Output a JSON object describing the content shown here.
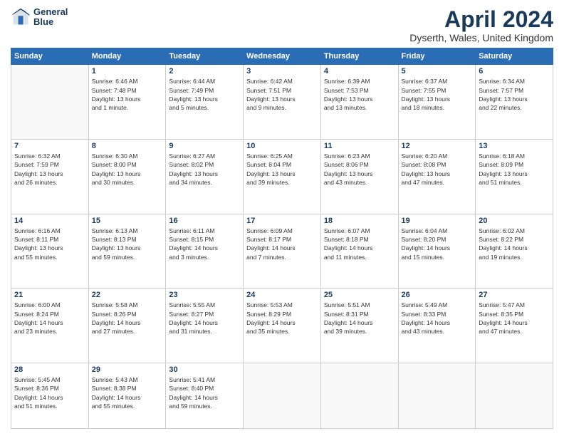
{
  "header": {
    "logo_line1": "General",
    "logo_line2": "Blue",
    "month": "April 2024",
    "location": "Dyserth, Wales, United Kingdom"
  },
  "days_of_week": [
    "Sunday",
    "Monday",
    "Tuesday",
    "Wednesday",
    "Thursday",
    "Friday",
    "Saturday"
  ],
  "weeks": [
    [
      {
        "day": "",
        "info": ""
      },
      {
        "day": "1",
        "info": "Sunrise: 6:46 AM\nSunset: 7:48 PM\nDaylight: 13 hours\nand 1 minute."
      },
      {
        "day": "2",
        "info": "Sunrise: 6:44 AM\nSunset: 7:49 PM\nDaylight: 13 hours\nand 5 minutes."
      },
      {
        "day": "3",
        "info": "Sunrise: 6:42 AM\nSunset: 7:51 PM\nDaylight: 13 hours\nand 9 minutes."
      },
      {
        "day": "4",
        "info": "Sunrise: 6:39 AM\nSunset: 7:53 PM\nDaylight: 13 hours\nand 13 minutes."
      },
      {
        "day": "5",
        "info": "Sunrise: 6:37 AM\nSunset: 7:55 PM\nDaylight: 13 hours\nand 18 minutes."
      },
      {
        "day": "6",
        "info": "Sunrise: 6:34 AM\nSunset: 7:57 PM\nDaylight: 13 hours\nand 22 minutes."
      }
    ],
    [
      {
        "day": "7",
        "info": "Sunrise: 6:32 AM\nSunset: 7:59 PM\nDaylight: 13 hours\nand 26 minutes."
      },
      {
        "day": "8",
        "info": "Sunrise: 6:30 AM\nSunset: 8:00 PM\nDaylight: 13 hours\nand 30 minutes."
      },
      {
        "day": "9",
        "info": "Sunrise: 6:27 AM\nSunset: 8:02 PM\nDaylight: 13 hours\nand 34 minutes."
      },
      {
        "day": "10",
        "info": "Sunrise: 6:25 AM\nSunset: 8:04 PM\nDaylight: 13 hours\nand 39 minutes."
      },
      {
        "day": "11",
        "info": "Sunrise: 6:23 AM\nSunset: 8:06 PM\nDaylight: 13 hours\nand 43 minutes."
      },
      {
        "day": "12",
        "info": "Sunrise: 6:20 AM\nSunset: 8:08 PM\nDaylight: 13 hours\nand 47 minutes."
      },
      {
        "day": "13",
        "info": "Sunrise: 6:18 AM\nSunset: 8:09 PM\nDaylight: 13 hours\nand 51 minutes."
      }
    ],
    [
      {
        "day": "14",
        "info": "Sunrise: 6:16 AM\nSunset: 8:11 PM\nDaylight: 13 hours\nand 55 minutes."
      },
      {
        "day": "15",
        "info": "Sunrise: 6:13 AM\nSunset: 8:13 PM\nDaylight: 13 hours\nand 59 minutes."
      },
      {
        "day": "16",
        "info": "Sunrise: 6:11 AM\nSunset: 8:15 PM\nDaylight: 14 hours\nand 3 minutes."
      },
      {
        "day": "17",
        "info": "Sunrise: 6:09 AM\nSunset: 8:17 PM\nDaylight: 14 hours\nand 7 minutes."
      },
      {
        "day": "18",
        "info": "Sunrise: 6:07 AM\nSunset: 8:18 PM\nDaylight: 14 hours\nand 11 minutes."
      },
      {
        "day": "19",
        "info": "Sunrise: 6:04 AM\nSunset: 8:20 PM\nDaylight: 14 hours\nand 15 minutes."
      },
      {
        "day": "20",
        "info": "Sunrise: 6:02 AM\nSunset: 8:22 PM\nDaylight: 14 hours\nand 19 minutes."
      }
    ],
    [
      {
        "day": "21",
        "info": "Sunrise: 6:00 AM\nSunset: 8:24 PM\nDaylight: 14 hours\nand 23 minutes."
      },
      {
        "day": "22",
        "info": "Sunrise: 5:58 AM\nSunset: 8:26 PM\nDaylight: 14 hours\nand 27 minutes."
      },
      {
        "day": "23",
        "info": "Sunrise: 5:55 AM\nSunset: 8:27 PM\nDaylight: 14 hours\nand 31 minutes."
      },
      {
        "day": "24",
        "info": "Sunrise: 5:53 AM\nSunset: 8:29 PM\nDaylight: 14 hours\nand 35 minutes."
      },
      {
        "day": "25",
        "info": "Sunrise: 5:51 AM\nSunset: 8:31 PM\nDaylight: 14 hours\nand 39 minutes."
      },
      {
        "day": "26",
        "info": "Sunrise: 5:49 AM\nSunset: 8:33 PM\nDaylight: 14 hours\nand 43 minutes."
      },
      {
        "day": "27",
        "info": "Sunrise: 5:47 AM\nSunset: 8:35 PM\nDaylight: 14 hours\nand 47 minutes."
      }
    ],
    [
      {
        "day": "28",
        "info": "Sunrise: 5:45 AM\nSunset: 8:36 PM\nDaylight: 14 hours\nand 51 minutes."
      },
      {
        "day": "29",
        "info": "Sunrise: 5:43 AM\nSunset: 8:38 PM\nDaylight: 14 hours\nand 55 minutes."
      },
      {
        "day": "30",
        "info": "Sunrise: 5:41 AM\nSunset: 8:40 PM\nDaylight: 14 hours\nand 59 minutes."
      },
      {
        "day": "",
        "info": ""
      },
      {
        "day": "",
        "info": ""
      },
      {
        "day": "",
        "info": ""
      },
      {
        "day": "",
        "info": ""
      }
    ]
  ]
}
